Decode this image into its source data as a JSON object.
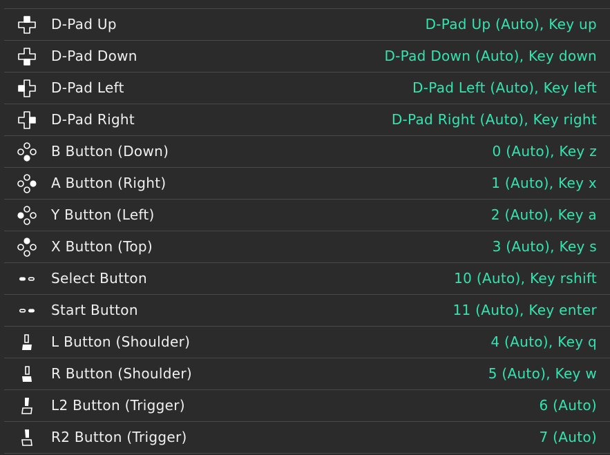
{
  "bindings": [
    {
      "icon": "dpad-up-icon",
      "label": "D-Pad Up",
      "value": "D-Pad Up (Auto), Key up"
    },
    {
      "icon": "dpad-down-icon",
      "label": "D-Pad Down",
      "value": "D-Pad Down (Auto), Key down"
    },
    {
      "icon": "dpad-left-icon",
      "label": "D-Pad Left",
      "value": "D-Pad Left (Auto), Key left"
    },
    {
      "icon": "dpad-right-icon",
      "label": "D-Pad Right",
      "value": "D-Pad Right (Auto), Key right"
    },
    {
      "icon": "face-button-down-icon",
      "label": "B Button (Down)",
      "value": "0 (Auto), Key z"
    },
    {
      "icon": "face-button-right-icon",
      "label": "A Button (Right)",
      "value": "1 (Auto), Key x"
    },
    {
      "icon": "face-button-left-icon",
      "label": "Y Button (Left)",
      "value": "2 (Auto), Key a"
    },
    {
      "icon": "face-button-top-icon",
      "label": "X Button (Top)",
      "value": "3 (Auto), Key s"
    },
    {
      "icon": "select-button-icon",
      "label": "Select Button",
      "value": "10 (Auto), Key rshift"
    },
    {
      "icon": "start-button-icon",
      "label": "Start Button",
      "value": "11 (Auto), Key enter"
    },
    {
      "icon": "left-shoulder-icon",
      "label": "L Button (Shoulder)",
      "value": "4 (Auto), Key q"
    },
    {
      "icon": "right-shoulder-icon",
      "label": "R Button (Shoulder)",
      "value": "5 (Auto), Key w"
    },
    {
      "icon": "left-trigger-icon",
      "label": "L2 Button (Trigger)",
      "value": "6 (Auto)"
    },
    {
      "icon": "right-trigger-icon",
      "label": "R2 Button (Trigger)",
      "value": "7 (Auto)"
    }
  ],
  "colors": {
    "background": "#2b2b2b",
    "label": "#f0f0f0",
    "value": "#2fe6b0",
    "divider": "#4a4a4a"
  }
}
